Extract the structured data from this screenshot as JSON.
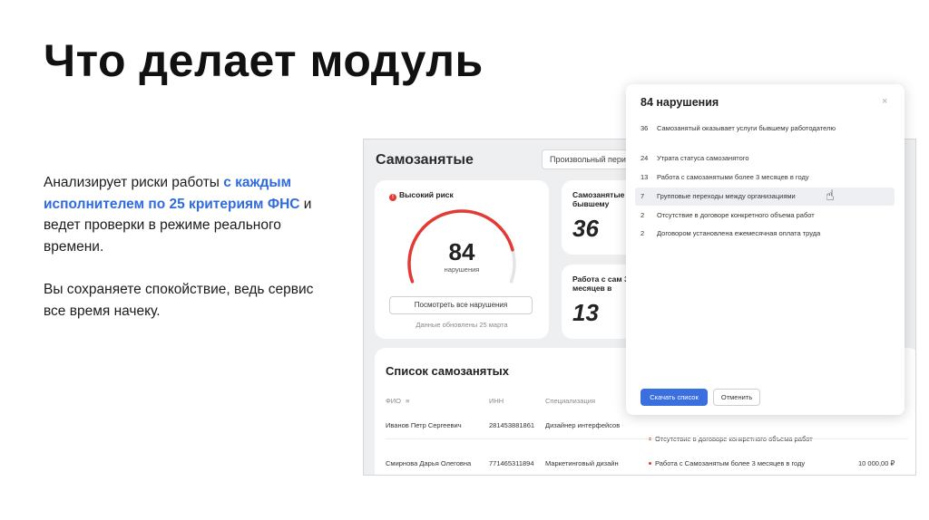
{
  "slide": {
    "title": "Что делает модуль",
    "para1_a": "Анализирует риски работы ",
    "para1_b": "с каждым исполнителем по 25 критериям ФНС",
    "para1_c": " и ведет проверки в режиме реального времени.",
    "para2": "Вы сохраняете спокойствие, ведь сервис все время начеку."
  },
  "app": {
    "title": "Самозанятые",
    "period": "Произвольный период",
    "risk_card": {
      "label": "Высокий риск",
      "value": "84",
      "value_num": 84,
      "gauge_fraction": 0.84,
      "sub": "нарушения",
      "button": "Посмотреть все нарушения",
      "updated": "Данные обновлены 25 марта"
    },
    "card_a": {
      "label": "Самозанятые бывшему",
      "value": "36"
    },
    "card_b": {
      "label": "Работа с сам 3 месяцев в",
      "value": "13"
    },
    "list": {
      "title": "Список самозанятых",
      "headers": [
        "ФИО",
        "ИНН",
        "Специализация"
      ],
      "rows": [
        {
          "name": "Иванов Петр Сергеевич",
          "inn": "281453881861",
          "spec": "Дизайнер интерфейсов",
          "violation": "Отсутствие в договоре конкретного объема работ",
          "amount": ""
        },
        {
          "name": "Смирнова Дарья Олеговна",
          "inn": "771465311894",
          "spec": "Маркетинговый дизайн",
          "violation": "Работа с Самозанятым более 3 месяцев в году",
          "amount": "10 000,00 ₽"
        }
      ]
    }
  },
  "modal": {
    "title": "84 нарушения",
    "close": "×",
    "items": [
      {
        "count": "36",
        "text": "Самозанятый оказывает услуги бывшему работодателю"
      },
      {
        "count": "24",
        "text": "Утрата статуса самозанятого"
      },
      {
        "count": "13",
        "text": "Работа с самозанятыми более 3 месяцев в году"
      },
      {
        "count": "7",
        "text": "Групповые переходы между организациями"
      },
      {
        "count": "2",
        "text": "Отсутствие в договоре конкретного объема работ"
      },
      {
        "count": "2",
        "text": "Договором установлена ежемесячная оплата труда"
      }
    ],
    "primary_button": "Скачать список",
    "secondary_button": "Отменить"
  },
  "colors": {
    "accent": "#3a6fe0",
    "highlight_text": "#2f6bdc",
    "risk": "#e53935"
  },
  "icons": {
    "cursor": "pointing-hand-icon",
    "filter": "filter-icon",
    "risk": "alert-icon"
  }
}
